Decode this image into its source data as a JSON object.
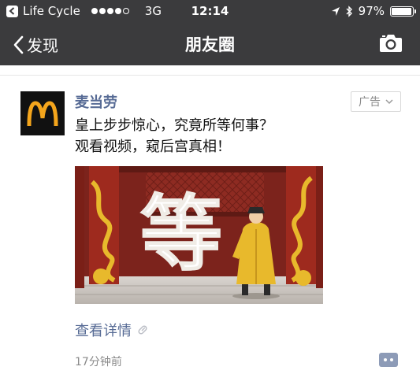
{
  "status_bar": {
    "carrier": "Life Cycle",
    "network": "3G",
    "time": "12:14",
    "battery": "97%",
    "battery_level": 0.97
  },
  "nav": {
    "back_label": "发现",
    "title": "朋友圈"
  },
  "post": {
    "author": "麦当劳",
    "ad_label": "广告",
    "text_line1": "皇上步步惊心，究竟所等何事？",
    "text_line2": "观看视频，窥后宫真相！",
    "image_character": "等",
    "link_label": "查看详情",
    "timestamp": "17分钟前"
  },
  "colors": {
    "bar_bg": "#3b3b3d",
    "link": "#576b95",
    "mcd_gold": "#f4a51c",
    "pillar_red": "#9e2a1e",
    "robe_yellow": "#e8b92c"
  }
}
